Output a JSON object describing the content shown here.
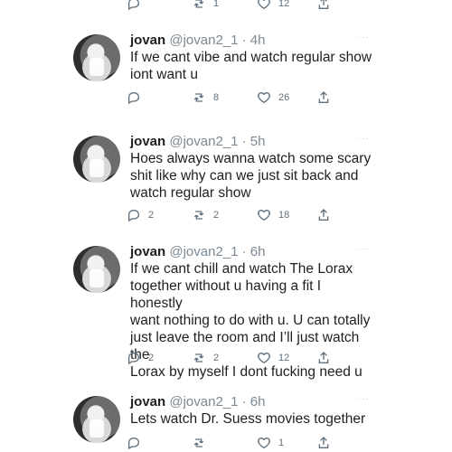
{
  "top_partial": {
    "retweets": "1",
    "likes": "12"
  },
  "tweets": [
    {
      "name": "jovan",
      "handle": "@jovan2_1 · 4h",
      "text": "If we cant vibe and watch regular show\niont want u",
      "replies": "",
      "retweets": "8",
      "likes": "26"
    },
    {
      "name": "jovan",
      "handle": "@jovan2_1 · 5h",
      "text": "Hoes always wanna watch some scary\nshit like why can we just sit back and\nwatch regular show",
      "replies": "2",
      "retweets": "2",
      "likes": "18"
    },
    {
      "name": "jovan",
      "handle": "@jovan2_1 · 6h",
      "text": "If we cant chill and watch The Lorax\ntogether without u having a fit I honestly\nwant nothing to do with u. U can totally\njust leave the room and I’ll just watch the\nLorax by myself I dont fucking need u",
      "replies": "2",
      "retweets": "2",
      "likes": "12"
    },
    {
      "name": "jovan",
      "handle": "@jovan2_1 · 6h",
      "text": "Lets watch Dr. Suess movies together",
      "replies": "",
      "retweets": "",
      "likes": "1"
    }
  ]
}
